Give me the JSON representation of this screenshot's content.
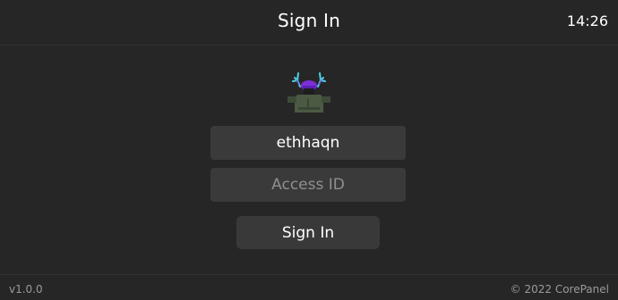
{
  "header": {
    "title": "Sign In",
    "time": "14:26"
  },
  "avatar": {
    "icon": "avatar-antlers-icon"
  },
  "form": {
    "username_value": "ethhaqn",
    "access_id_placeholder": "Access ID",
    "signin_label": "Sign In"
  },
  "footer": {
    "version": "v1.0.0",
    "copyright": "© 2022 CorePanel"
  },
  "colors": {
    "background": "#262626",
    "field": "#3a3a3a",
    "button": "#393939",
    "muted_text": "#9a9a9a",
    "placeholder_text": "#8f8f8f"
  }
}
